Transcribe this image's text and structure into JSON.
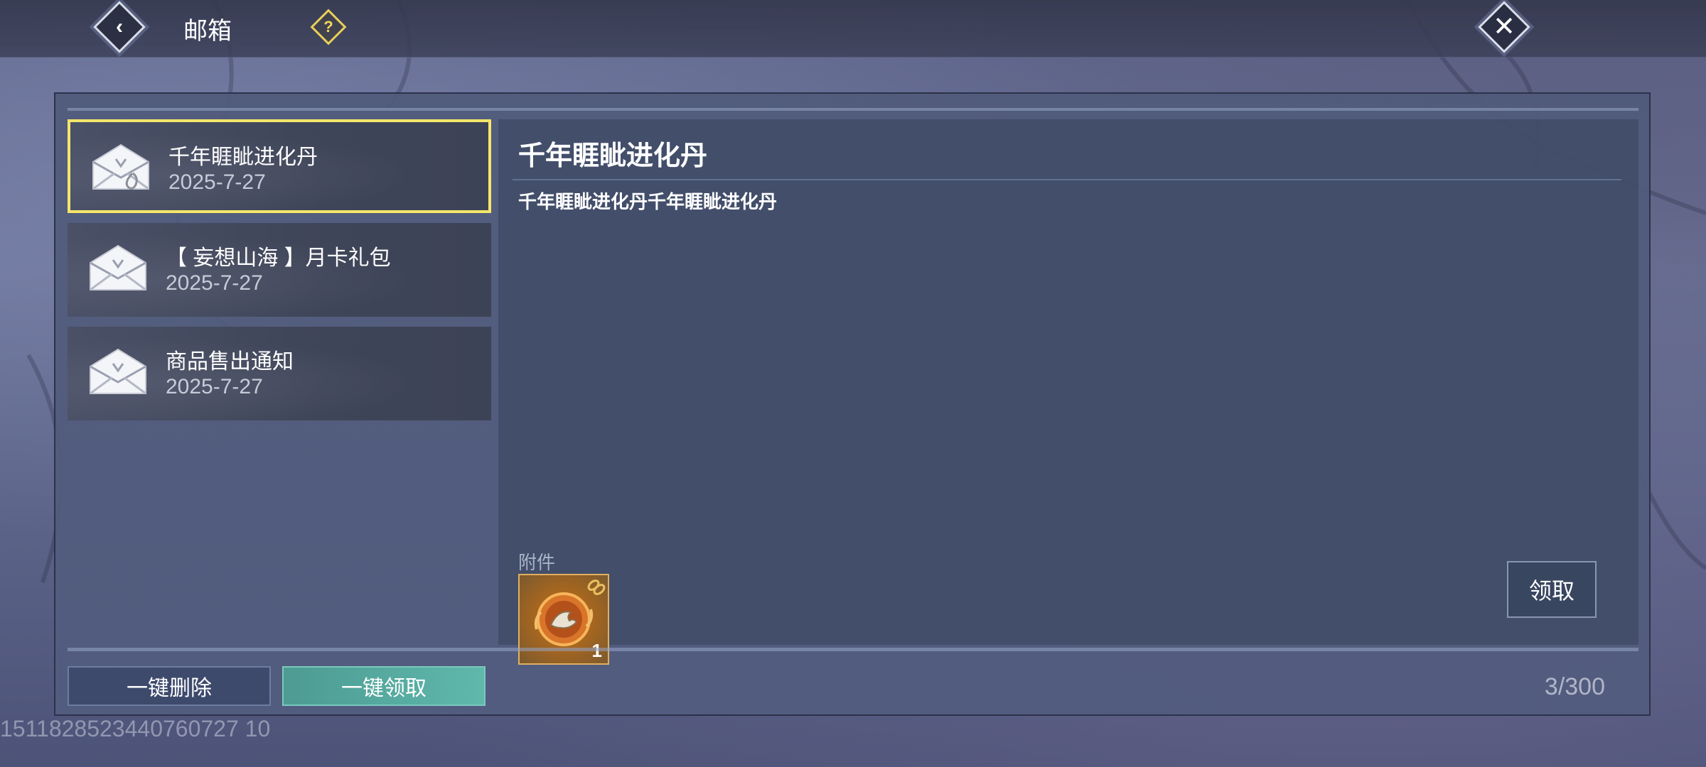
{
  "header": {
    "title": "邮箱",
    "back_icon": "back-arrow-icon",
    "help_icon": "question-icon",
    "close_icon": "close-icon"
  },
  "mail_list": [
    {
      "title": "千年睚眦进化丹",
      "date": "2025-7-27",
      "selected": true,
      "has_attachment": true
    },
    {
      "title": "【 妄想山海 】月卡礼包",
      "date": "2025-7-27",
      "selected": false,
      "has_attachment": false
    },
    {
      "title": "商品售出通知",
      "date": "2025-7-27",
      "selected": false,
      "has_attachment": false
    }
  ],
  "detail": {
    "title": "千年睚眦进化丹",
    "body": "千年睚眦进化丹千年睚眦进化丹",
    "attachment_label": "附件",
    "attachment": {
      "quantity": "1",
      "icon": "dragon-orb-icon"
    },
    "claim_label": "领取"
  },
  "footer": {
    "delete_all_label": "一键删除",
    "claim_all_label": "一键领取",
    "count": "3/300"
  },
  "uid": "1511828523440760727 10",
  "colors": {
    "selected_border": "#f4e66a",
    "claim_all_bg": "#5fb8ab",
    "help_icon": "#e8cf58"
  }
}
